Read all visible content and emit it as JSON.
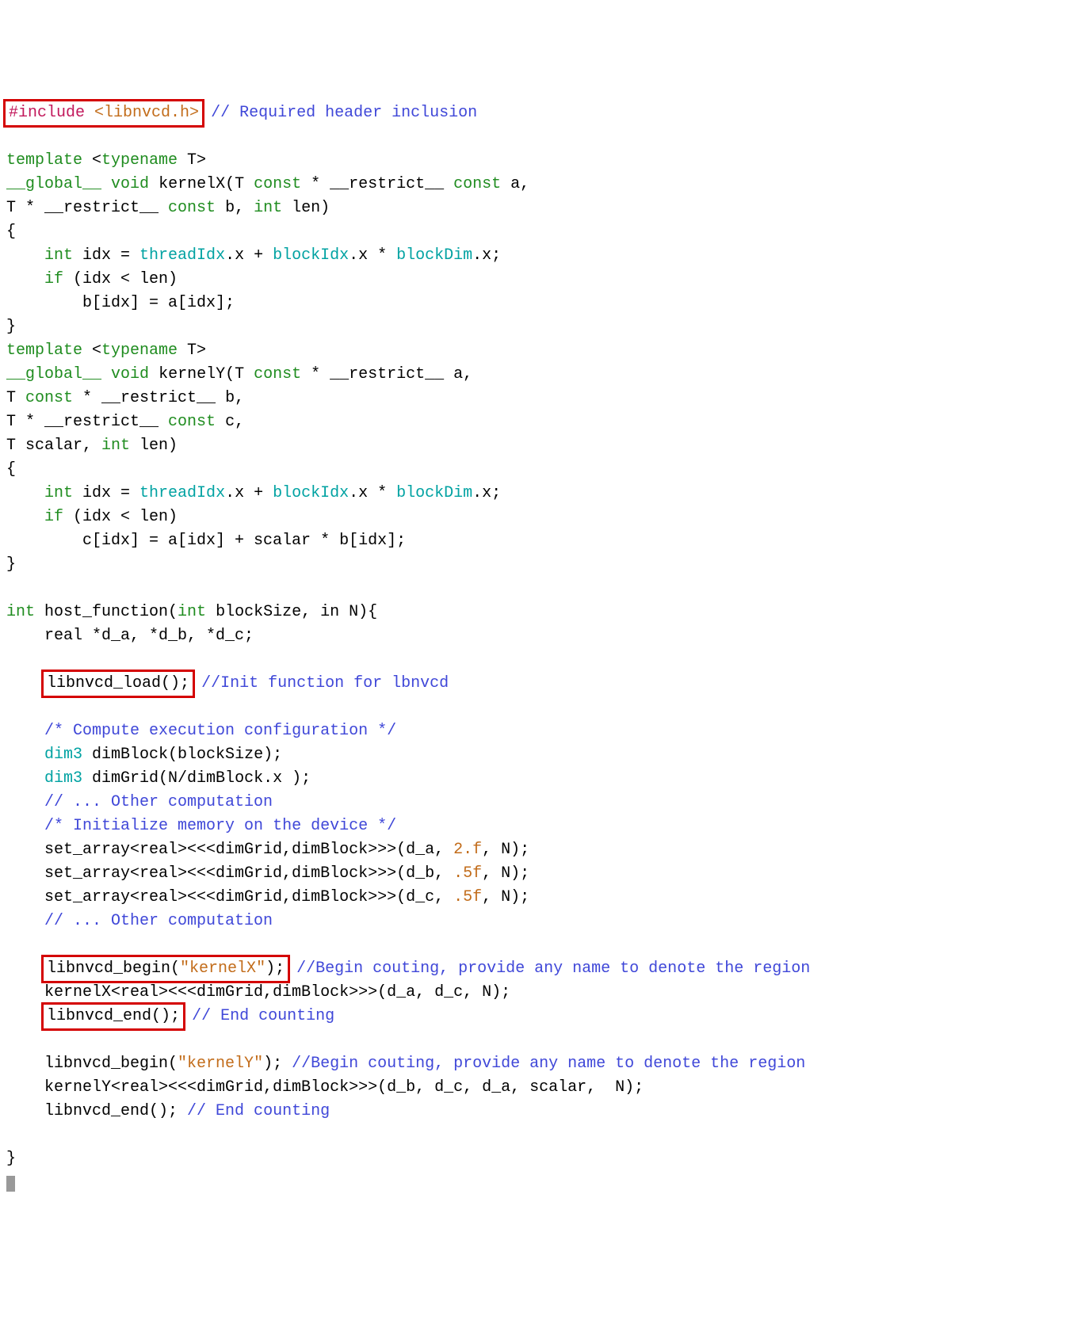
{
  "code": {
    "l01a": "#include",
    "l01b": " <libnvcd.h>",
    "l01c": "// Required header inclusion",
    "l02": "",
    "l03a": "template",
    "l03b": " <",
    "l03c": "typename",
    "l03d": " T>",
    "l04a": "__global__",
    "l04b": " ",
    "l04c": "void",
    "l04d": " kernelX(T ",
    "l04e": "const",
    "l04f": " * __restrict__ ",
    "l04g": "const",
    "l04h": " a,",
    "l05a": "T * __restrict__ ",
    "l05b": "const",
    "l05c": " b, ",
    "l05d": "int",
    "l05e": " len)",
    "l06": "{",
    "l07a": "    ",
    "l07b": "int",
    "l07c": " idx = ",
    "l07d": "threadIdx",
    "l07e": ".x + ",
    "l07f": "blockIdx",
    "l07g": ".x * ",
    "l07h": "blockDim",
    "l07i": ".x;",
    "l08a": "    ",
    "l08b": "if",
    "l08c": " (idx < len)",
    "l09": "        b[idx] = a[idx];",
    "l10": "}",
    "l11a": "template",
    "l11b": " <",
    "l11c": "typename",
    "l11d": " T>",
    "l12a": "__global__",
    "l12b": " ",
    "l12c": "void",
    "l12d": " kernelY(T ",
    "l12e": "const",
    "l12f": " * __restrict__ a,",
    "l13a": "T ",
    "l13b": "const",
    "l13c": " * __restrict__ b,",
    "l14a": "T * __restrict__ ",
    "l14b": "const",
    "l14c": " c,",
    "l15a": "T scalar, ",
    "l15b": "int",
    "l15c": " len)",
    "l16": "{",
    "l17a": "    ",
    "l17b": "int",
    "l17c": " idx = ",
    "l17d": "threadIdx",
    "l17e": ".x + ",
    "l17f": "blockIdx",
    "l17g": ".x * ",
    "l17h": "blockDim",
    "l17i": ".x;",
    "l18a": "    ",
    "l18b": "if",
    "l18c": " (idx < len)",
    "l19": "        c[idx] = a[idx] + scalar * b[idx];",
    "l20": "}",
    "l21": "",
    "l22a": "int",
    "l22b": " host_function(",
    "l22c": "int",
    "l22d": " blockSize, in N){",
    "l23": "    real *d_a, *d_b, *d_c;",
    "l24": "",
    "l25a": "    ",
    "l25b": "libnvcd_load();",
    "l25c": " ",
    "l25d": "//Init function for lbnvcd",
    "l26": "",
    "l27a": "    ",
    "l27b": "/* Compute execution configuration */",
    "l28a": "    ",
    "l28b": "dim3",
    "l28c": " dimBlock(blockSize);",
    "l29a": "    ",
    "l29b": "dim3",
    "l29c": " dimGrid(N/dimBlock.x );",
    "l30a": "    ",
    "l30b": "// ... Other computation",
    "l31a": "    ",
    "l31b": "/* Initialize memory on the device */",
    "l32a": "    set_array<real><<<dimGrid,dimBlock>>>(d_a, ",
    "l32b": "2.f",
    "l32c": ", N);",
    "l33a": "    set_array<real><<<dimGrid,dimBlock>>>(d_b, ",
    "l33b": ".5f",
    "l33c": ", N);",
    "l34a": "    set_array<real><<<dimGrid,dimBlock>>>(d_c, ",
    "l34b": ".5f",
    "l34c": ", N);",
    "l35a": "    ",
    "l35b": "// ... Other computation",
    "l36": "",
    "l37a": "    ",
    "l37b": "libnvcd_begin(",
    "l37c": "\"kernelX\"",
    "l37d": ");",
    "l37e": " ",
    "l37f": "//Begin couting, provide any name to denote the region",
    "l38": "    kernelX<real><<<dimGrid,dimBlock>>>(d_a, d_c, N);",
    "l39a": "    ",
    "l39b": "libnvcd_end();",
    "l39c": " ",
    "l39d": "// End counting",
    "l40": "",
    "l41a": "    libnvcd_begin(",
    "l41b": "\"kernelY\"",
    "l41c": "); ",
    "l41d": "//Begin couting, provide any name to denote the region",
    "l42": "    kernelY<real><<<dimGrid,dimBlock>>>(d_b, d_c, d_a, scalar,  N);",
    "l43a": "    libnvcd_end(); ",
    "l43b": "// End counting",
    "l44": "",
    "l45": "}"
  },
  "highlights": [
    "include-line",
    "libnvcd-load-call",
    "libnvcd-begin-kernelx",
    "libnvcd-end-kernelx"
  ]
}
